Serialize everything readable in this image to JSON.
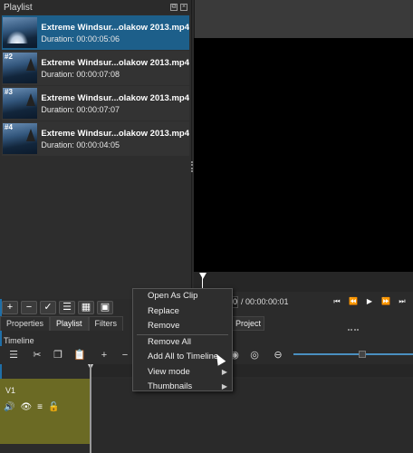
{
  "playlist": {
    "title": "Playlist",
    "items": [
      {
        "num": "",
        "title": "Extreme Windsur...olakow 2013.mp4",
        "duration": "Duration: 00:00:05:06"
      },
      {
        "num": "#2",
        "title": "Extreme Windsur...olakow 2013.mp4",
        "duration": "Duration: 00:00:07:08"
      },
      {
        "num": "#3",
        "title": "Extreme Windsur...olakow 2013.mp4",
        "duration": "Duration: 00:00:07:07"
      },
      {
        "num": "#4",
        "title": "Extreme Windsur...olakow 2013.mp4",
        "duration": "Duration: 00:00:04:05"
      }
    ]
  },
  "tabs": {
    "properties": "Properties",
    "playlist": "Playlist",
    "filters": "Filters",
    "project": "Project"
  },
  "player": {
    "timecode": "0",
    "duration": "/ 00:00:00:01"
  },
  "timeline": {
    "label": "Timeline",
    "track_name": "V1"
  },
  "menu": {
    "items": [
      "Open As Clip",
      "Replace",
      "Remove",
      "Remove All",
      "Add All to Timeline",
      "View mode",
      "Thumbnails"
    ]
  }
}
